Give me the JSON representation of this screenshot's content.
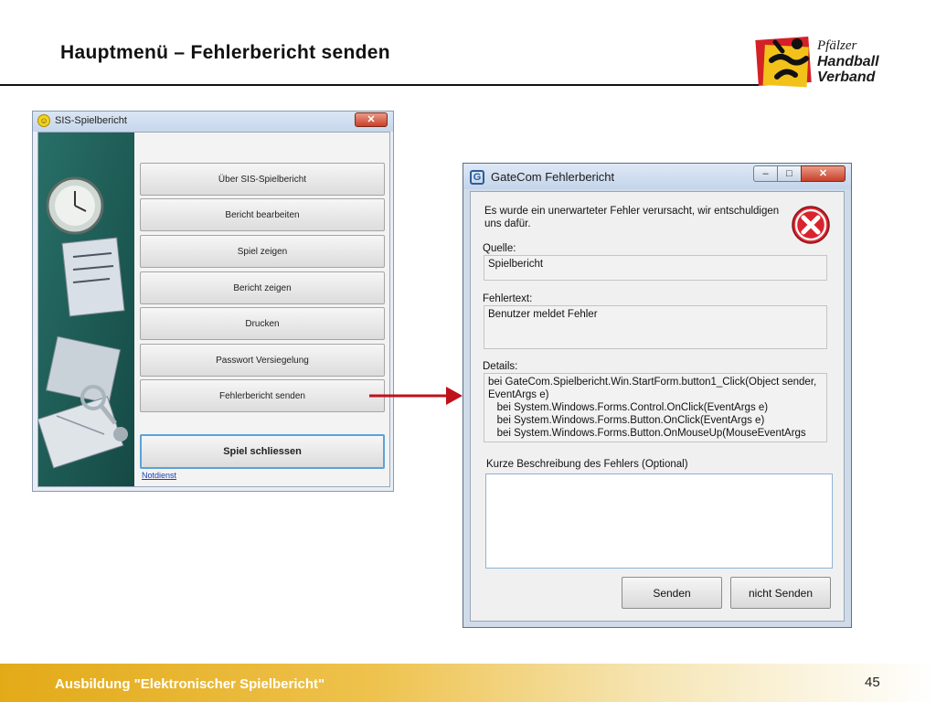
{
  "slide": {
    "title": "Hauptmenü – Fehlerbericht senden",
    "footer_text": "Ausbildung \"Elektronischer Spielbericht\"",
    "page_number": "45"
  },
  "logo": {
    "line1": "Pfälzer",
    "line2": "Handball",
    "line3": "Verband"
  },
  "main_window": {
    "title": "SIS-Spielbericht",
    "buttons": [
      "Über SIS-Spielbericht",
      "Bericht bearbeiten",
      "Spiel zeigen",
      "Bericht zeigen",
      "Drucken",
      "Passwort Versiegelung",
      "Fehlerbericht senden"
    ],
    "close_game_label": "Spiel schliessen",
    "emergency_link": "Notdienst"
  },
  "error_window": {
    "title": "GateCom Fehlerbericht",
    "message": "Es wurde ein unerwarteter Fehler verursacht, wir entschuldigen uns dafür.",
    "source_label": "Quelle:",
    "source_value": "Spielbericht",
    "errortext_label": "Fehlertext:",
    "errortext_value": "Benutzer meldet Fehler",
    "details_label": "Details:",
    "details_value": "bei GateCom.Spielbericht.Win.StartForm.button1_Click(Object sender,\nEventArgs e)\n   bei System.Windows.Forms.Control.OnClick(EventArgs e)\n   bei System.Windows.Forms.Button.OnClick(EventArgs e)\n   bei System.Windows.Forms.Button.OnMouseUp(MouseEventArgs",
    "description_label": "Kurze Beschreibung des Fehlers (Optional)",
    "description_value": "",
    "send_label": "Senden",
    "dont_send_label": "nicht Senden"
  },
  "colors": {
    "accent_arrow": "#c0101a",
    "footer_gold": "#e3aa18",
    "error_red": "#d9232d"
  }
}
